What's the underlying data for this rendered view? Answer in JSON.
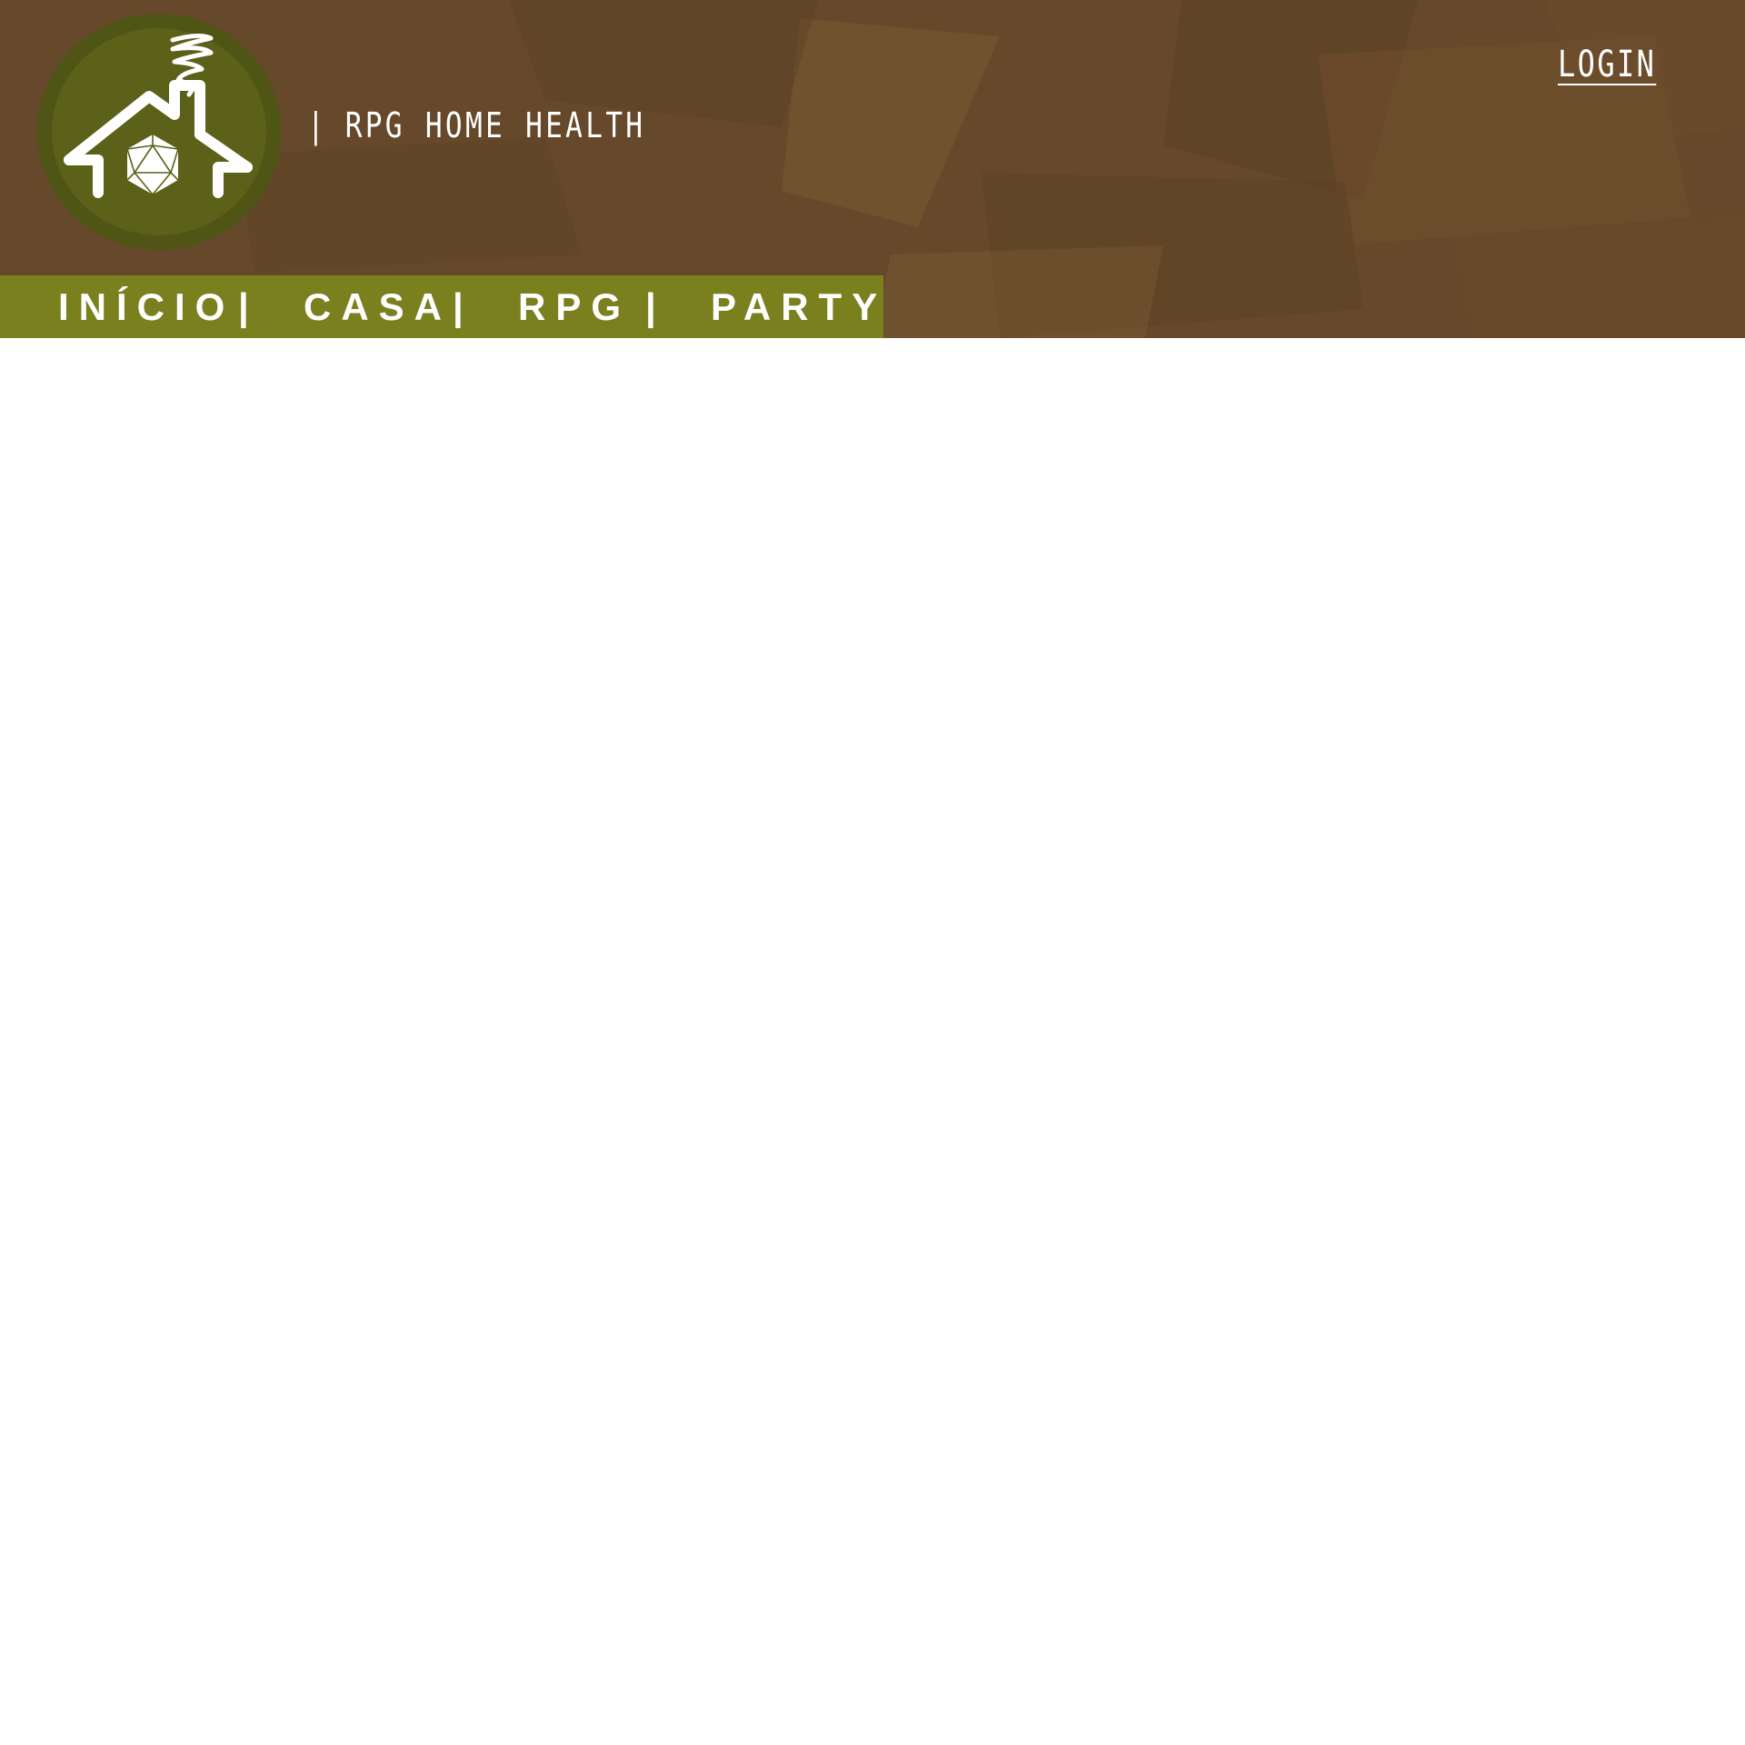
{
  "header": {
    "site_title": "RPG HOME HEALTH",
    "title_separator": "|",
    "login_label": "LOGIN",
    "logo_icon": "house-d20-chimney-logo"
  },
  "nav": {
    "items": [
      {
        "label": "INÍCIO"
      },
      {
        "label": "CASA"
      },
      {
        "label": "RPG"
      },
      {
        "label": "PARTY"
      }
    ],
    "separator": "|"
  },
  "colors": {
    "header_brown": "#65492a",
    "nav_olive": "#7a801e",
    "logo_green": "#5b6118",
    "text": "#ffffff"
  }
}
